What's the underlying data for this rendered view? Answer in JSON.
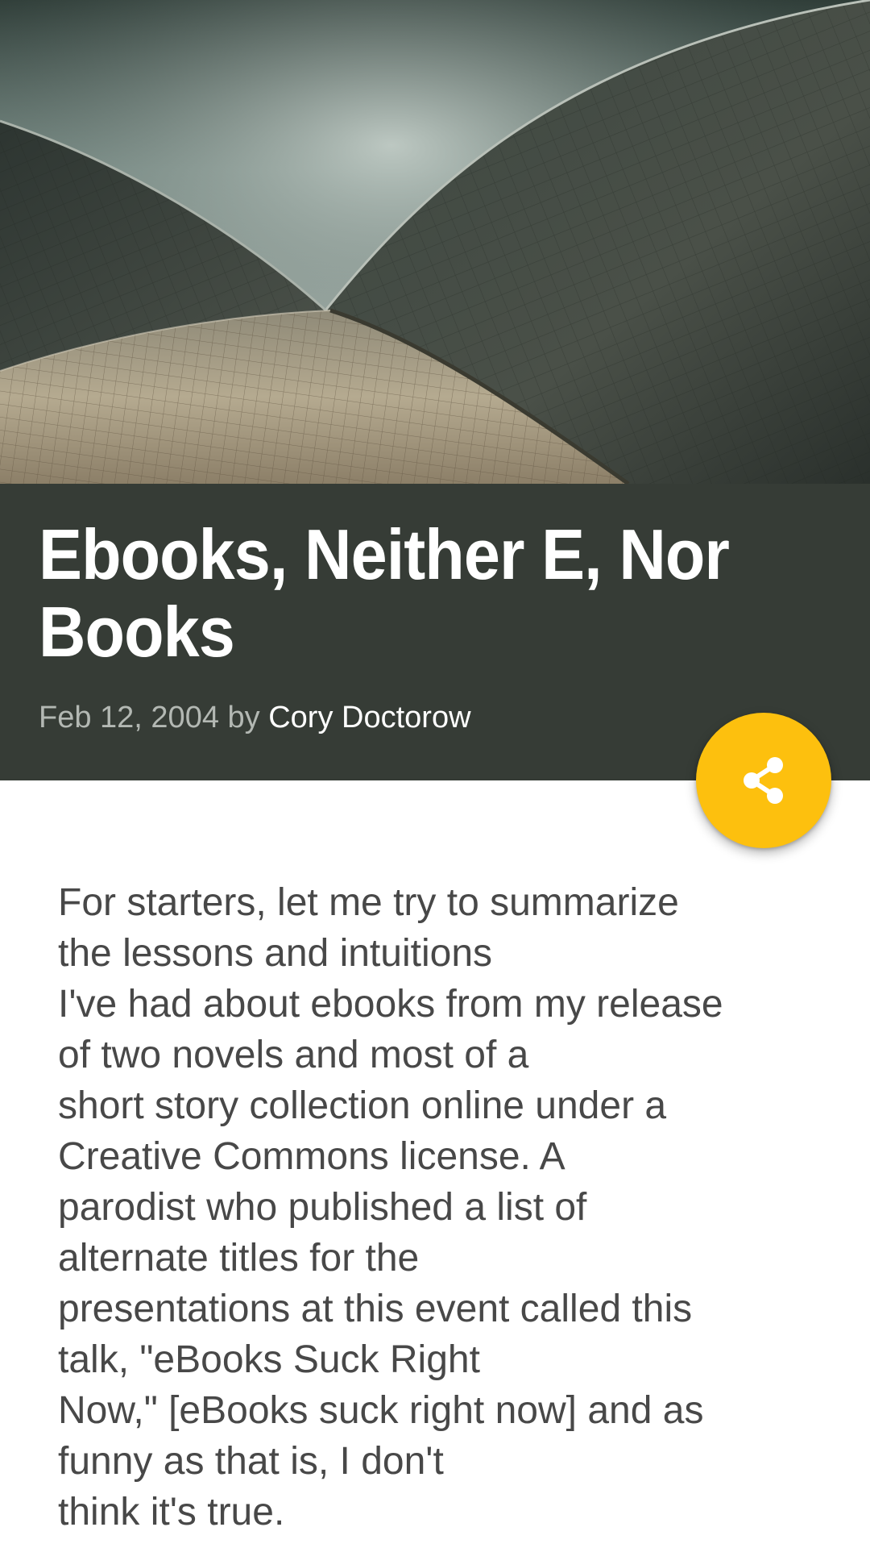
{
  "article": {
    "title": "Ebooks, Neither E, Nor Books",
    "date": "Feb 12, 2004",
    "by": "by",
    "author": "Cory Doctorow",
    "body_lines": [
      "For starters, let me try to summarize",
      "the lessons and intuitions",
      "I've had about ebooks from my release",
      "of two novels and most of a",
      "short story collection online under a",
      "Creative Commons license. A",
      "parodist who published a list of",
      "alternate titles for the",
      "presentations at this event called this",
      "talk, \"eBooks Suck Right",
      "Now,\" [eBooks suck right now] and as",
      "funny as that is, I don't",
      "think it's true."
    ]
  },
  "share_button": {
    "icon": "share-icon"
  },
  "colors": {
    "header_bg": "#363c36",
    "fab": "#fdc00e",
    "title": "#ffffff",
    "meta": "#b3b8b3",
    "body_text": "#484848"
  }
}
